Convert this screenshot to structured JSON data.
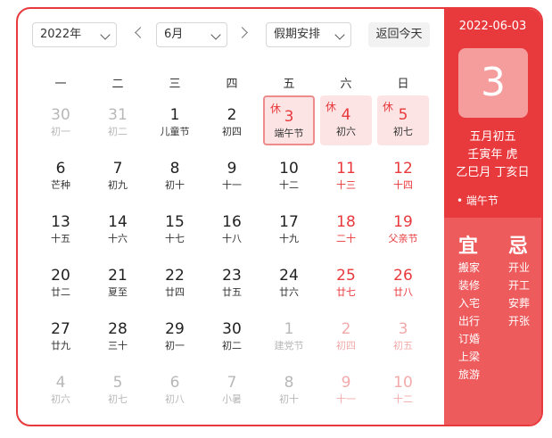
{
  "toolbar": {
    "year": "2022年",
    "month": "6月",
    "holiday": "假期安排",
    "today_btn": "返回今天"
  },
  "weekdays": [
    "一",
    "二",
    "三",
    "四",
    "五",
    "六",
    "日"
  ],
  "holiday_badge": "休",
  "days": [
    {
      "n": "30",
      "s": "初一",
      "t": "dim"
    },
    {
      "n": "31",
      "s": "初二",
      "t": "dim"
    },
    {
      "n": "1",
      "s": "儿童节",
      "t": ""
    },
    {
      "n": "2",
      "s": "初四",
      "t": ""
    },
    {
      "n": "3",
      "s": "端午节",
      "t": "today",
      "xiu": true
    },
    {
      "n": "4",
      "s": "初六",
      "t": "hol",
      "xiu": true
    },
    {
      "n": "5",
      "s": "初七",
      "t": "hol",
      "xiu": true
    },
    {
      "n": "6",
      "s": "芒种",
      "t": ""
    },
    {
      "n": "7",
      "s": "初九",
      "t": ""
    },
    {
      "n": "8",
      "s": "初十",
      "t": ""
    },
    {
      "n": "9",
      "s": "十一",
      "t": ""
    },
    {
      "n": "10",
      "s": "十二",
      "t": ""
    },
    {
      "n": "11",
      "s": "十三",
      "t": "red"
    },
    {
      "n": "12",
      "s": "十四",
      "t": "red"
    },
    {
      "n": "13",
      "s": "十五",
      "t": ""
    },
    {
      "n": "14",
      "s": "十六",
      "t": ""
    },
    {
      "n": "15",
      "s": "十七",
      "t": ""
    },
    {
      "n": "16",
      "s": "十八",
      "t": ""
    },
    {
      "n": "17",
      "s": "十九",
      "t": ""
    },
    {
      "n": "18",
      "s": "二十",
      "t": "red"
    },
    {
      "n": "19",
      "s": "父亲节",
      "t": "red"
    },
    {
      "n": "20",
      "s": "廿二",
      "t": ""
    },
    {
      "n": "21",
      "s": "夏至",
      "t": ""
    },
    {
      "n": "22",
      "s": "廿四",
      "t": ""
    },
    {
      "n": "23",
      "s": "廿五",
      "t": ""
    },
    {
      "n": "24",
      "s": "廿六",
      "t": ""
    },
    {
      "n": "25",
      "s": "廿七",
      "t": "red"
    },
    {
      "n": "26",
      "s": "廿八",
      "t": "red"
    },
    {
      "n": "27",
      "s": "廿九",
      "t": ""
    },
    {
      "n": "28",
      "s": "三十",
      "t": ""
    },
    {
      "n": "29",
      "s": "初一",
      "t": ""
    },
    {
      "n": "30",
      "s": "初二",
      "t": ""
    },
    {
      "n": "1",
      "s": "建党节",
      "t": "dim"
    },
    {
      "n": "2",
      "s": "初四",
      "t": "dimred"
    },
    {
      "n": "3",
      "s": "初五",
      "t": "dimred"
    },
    {
      "n": "4",
      "s": "初六",
      "t": "dim"
    },
    {
      "n": "5",
      "s": "初七",
      "t": "dim"
    },
    {
      "n": "6",
      "s": "初八",
      "t": "dim"
    },
    {
      "n": "7",
      "s": "小暑",
      "t": "dim"
    },
    {
      "n": "8",
      "s": "初十",
      "t": "dim"
    },
    {
      "n": "9",
      "s": "十一",
      "t": "dimred"
    },
    {
      "n": "10",
      "s": "十二",
      "t": "dimred"
    }
  ],
  "panel": {
    "date": "2022-06-03",
    "day": "3",
    "lunar": "五月初五",
    "year_gz": "壬寅年 虎",
    "month_day_gz": "乙巳月 丁亥日",
    "festival": "• 端午节",
    "yi_title": "宜",
    "ji_title": "忌",
    "yi": [
      "搬家",
      "装修",
      "入宅",
      "出行",
      "订婚",
      "上梁",
      "旅游"
    ],
    "ji": [
      "开业",
      "开工",
      "安葬",
      "开张"
    ]
  },
  "colors": {
    "accent": "#e8393d",
    "holiday_bg": "#fde4e4",
    "today_box": "#f59c9c",
    "yiji_bg": "#ed5b5d"
  }
}
